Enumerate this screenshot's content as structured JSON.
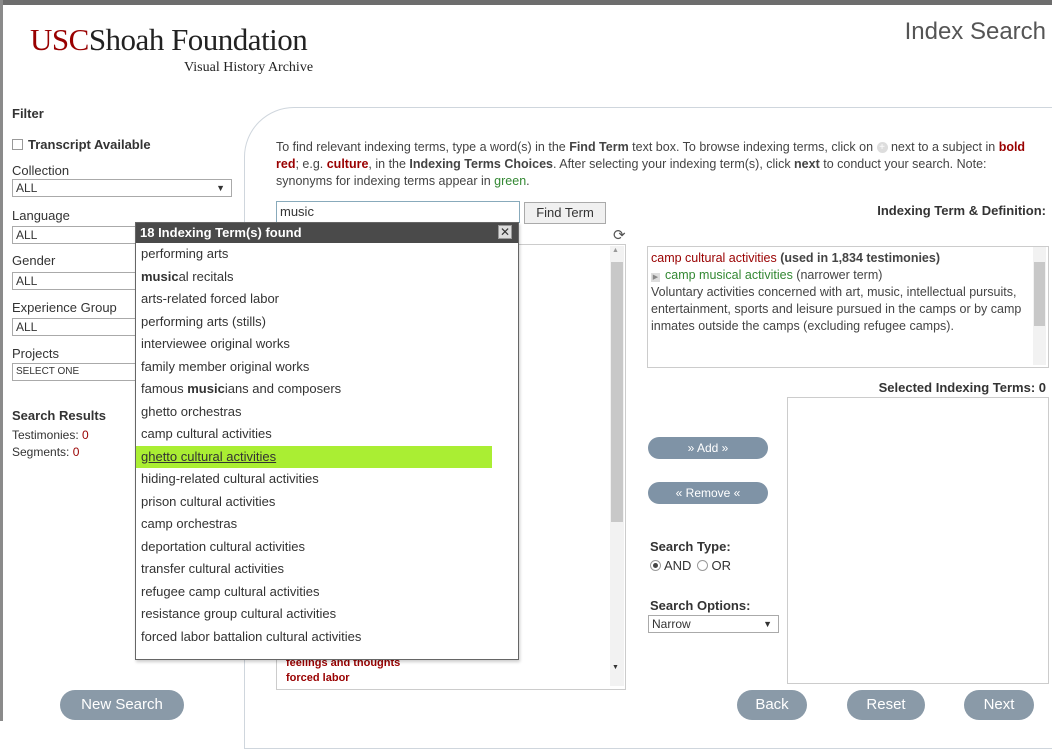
{
  "header": {
    "logo_usc": "USC",
    "logo_rest": "Shoah Foundation",
    "logo_sub": "Visual History Archive",
    "page_title": "Index Search"
  },
  "sidebar": {
    "filter_label": "Filter",
    "transcript_label": "Transcript Available",
    "collection_label": "Collection",
    "collection_value": "ALL",
    "language_label": "Language",
    "language_value": "ALL",
    "gender_label": "Gender",
    "gender_value": "ALL",
    "experience_label": "Experience Group",
    "experience_value": "ALL",
    "projects_label": "Projects",
    "projects_value": "SELECT ONE",
    "results_label": "Search Results",
    "testimonies_label": "Testimonies:",
    "testimonies_value": "0",
    "segments_label": "Segments:",
    "segments_value": "0",
    "new_search_label": "New Search"
  },
  "instructions": {
    "p1": "To find relevant indexing terms, type a word(s) in the ",
    "find_term_bold": "Find Term",
    "p2": " text box. To browse indexing terms, click on ",
    "p3": " next to a subject in ",
    "bold_red": "bold red",
    "p4": "; e.g. ",
    "culture": "culture",
    "p5": ", in the ",
    "choices_bold": "Indexing Terms Choices",
    "p6": ". After selecting your indexing term(s), click ",
    "next_bold": "next",
    "p7": " to conduct your search. Note: synonyms for indexing terms appear in ",
    "green": "green",
    "p8": "."
  },
  "search": {
    "term_value": "music",
    "find_button": "Find Term"
  },
  "dropdown": {
    "header": "18 Indexing Term(s) found",
    "items": [
      {
        "pre": "performing arts",
        "bold": "",
        "post": ""
      },
      {
        "pre": "",
        "bold": "music",
        "post": "al recitals"
      },
      {
        "pre": "arts-related forced labor",
        "bold": "",
        "post": ""
      },
      {
        "pre": "performing arts (stills)",
        "bold": "",
        "post": ""
      },
      {
        "pre": "interviewee original works",
        "bold": "",
        "post": ""
      },
      {
        "pre": "family member original works",
        "bold": "",
        "post": ""
      },
      {
        "pre": "famous ",
        "bold": "music",
        "post": "ians and composers"
      },
      {
        "pre": "ghetto orchestras",
        "bold": "",
        "post": ""
      },
      {
        "pre": "camp cultural activities",
        "bold": "",
        "post": ""
      },
      {
        "pre": "ghetto cultural activities",
        "bold": "",
        "post": ""
      },
      {
        "pre": "hiding-related cultural activities",
        "bold": "",
        "post": ""
      },
      {
        "pre": "prison cultural activities",
        "bold": "",
        "post": ""
      },
      {
        "pre": "camp orchestras",
        "bold": "",
        "post": ""
      },
      {
        "pre": "deportation cultural activities",
        "bold": "",
        "post": ""
      },
      {
        "pre": "transfer cultural activities",
        "bold": "",
        "post": ""
      },
      {
        "pre": "refugee camp cultural activities",
        "bold": "",
        "post": ""
      },
      {
        "pre": "resistance group cultural activities",
        "bold": "",
        "post": ""
      },
      {
        "pre": "forced labor battalion cultural activities",
        "bold": "",
        "post": ""
      }
    ],
    "highlighted_index": 9
  },
  "choices_background": {
    "item_a": "feelings and thoughts",
    "item_b": "forced labor"
  },
  "definition": {
    "title": "Indexing Term & Definition:",
    "term": "camp cultural activities",
    "used_in": " (used in 1,834 testimonies)",
    "narrower": "camp musical activities",
    "narrower_note": " (narrower term)",
    "text": "Voluntary activities concerned with art, music, intellectual pursuits, entertainment, sports and leisure pursued in the camps or by camp inmates outside the camps (excluding refugee camps)."
  },
  "selected": {
    "title": "Selected Indexing Terms: 0"
  },
  "actions": {
    "add_label": "» Add »",
    "remove_label": "« Remove «",
    "search_type_label": "Search Type:",
    "and_label": "AND",
    "or_label": "OR",
    "search_options_label": "Search Options:",
    "search_options_value": "Narrow"
  },
  "footer": {
    "back_label": "Back",
    "reset_label": "Reset",
    "next_label": "Next"
  },
  "colors": {
    "brand_red": "#990000",
    "highlight": "#aaee33",
    "button_grey_blue": "#8a9aa8"
  }
}
